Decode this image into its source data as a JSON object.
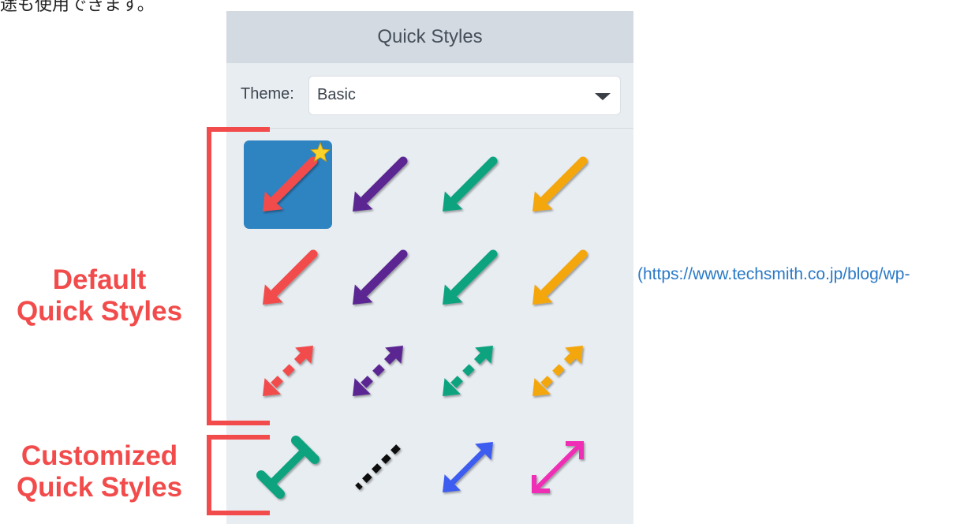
{
  "top_text": "途も使用できます。",
  "panel": {
    "title": "Quick Styles",
    "theme_label": "Theme:",
    "theme_value": "Basic"
  },
  "labels": {
    "default_line1": "Default",
    "default_line2": "Quick Styles",
    "custom_line1": "Customized",
    "custom_line2": "Quick Styles"
  },
  "link_text": "(https://www.techsmith.co.jp/blog/wp-",
  "colors": {
    "red": "#f24b4b",
    "purple": "#5b2592",
    "teal": "#10a37f",
    "orange": "#f4a60d",
    "black": "#111111",
    "blue": "#3e5bf0",
    "pink": "#f02eb5",
    "selected_bg": "#2e83c1",
    "star": "#f9d22a",
    "bracket": "#f24b4b",
    "link": "#2a79c6"
  },
  "styles": [
    {
      "style": "arrow-solid",
      "color": "red",
      "selected": true,
      "favorite": true
    },
    {
      "style": "arrow-solid",
      "color": "purple"
    },
    {
      "style": "arrow-solid",
      "color": "teal"
    },
    {
      "style": "arrow-solid",
      "color": "orange"
    },
    {
      "style": "arrow-solid",
      "color": "red"
    },
    {
      "style": "arrow-solid",
      "color": "purple"
    },
    {
      "style": "arrow-solid",
      "color": "teal"
    },
    {
      "style": "arrow-solid",
      "color": "orange"
    },
    {
      "style": "double-dashed",
      "color": "red"
    },
    {
      "style": "double-dashed",
      "color": "purple"
    },
    {
      "style": "double-dashed",
      "color": "teal"
    },
    {
      "style": "double-dashed",
      "color": "orange"
    },
    {
      "style": "dimension-line",
      "color": "teal"
    },
    {
      "style": "dashed-line",
      "color": "black"
    },
    {
      "style": "double-solid",
      "color": "blue"
    },
    {
      "style": "double-open",
      "color": "pink"
    }
  ]
}
